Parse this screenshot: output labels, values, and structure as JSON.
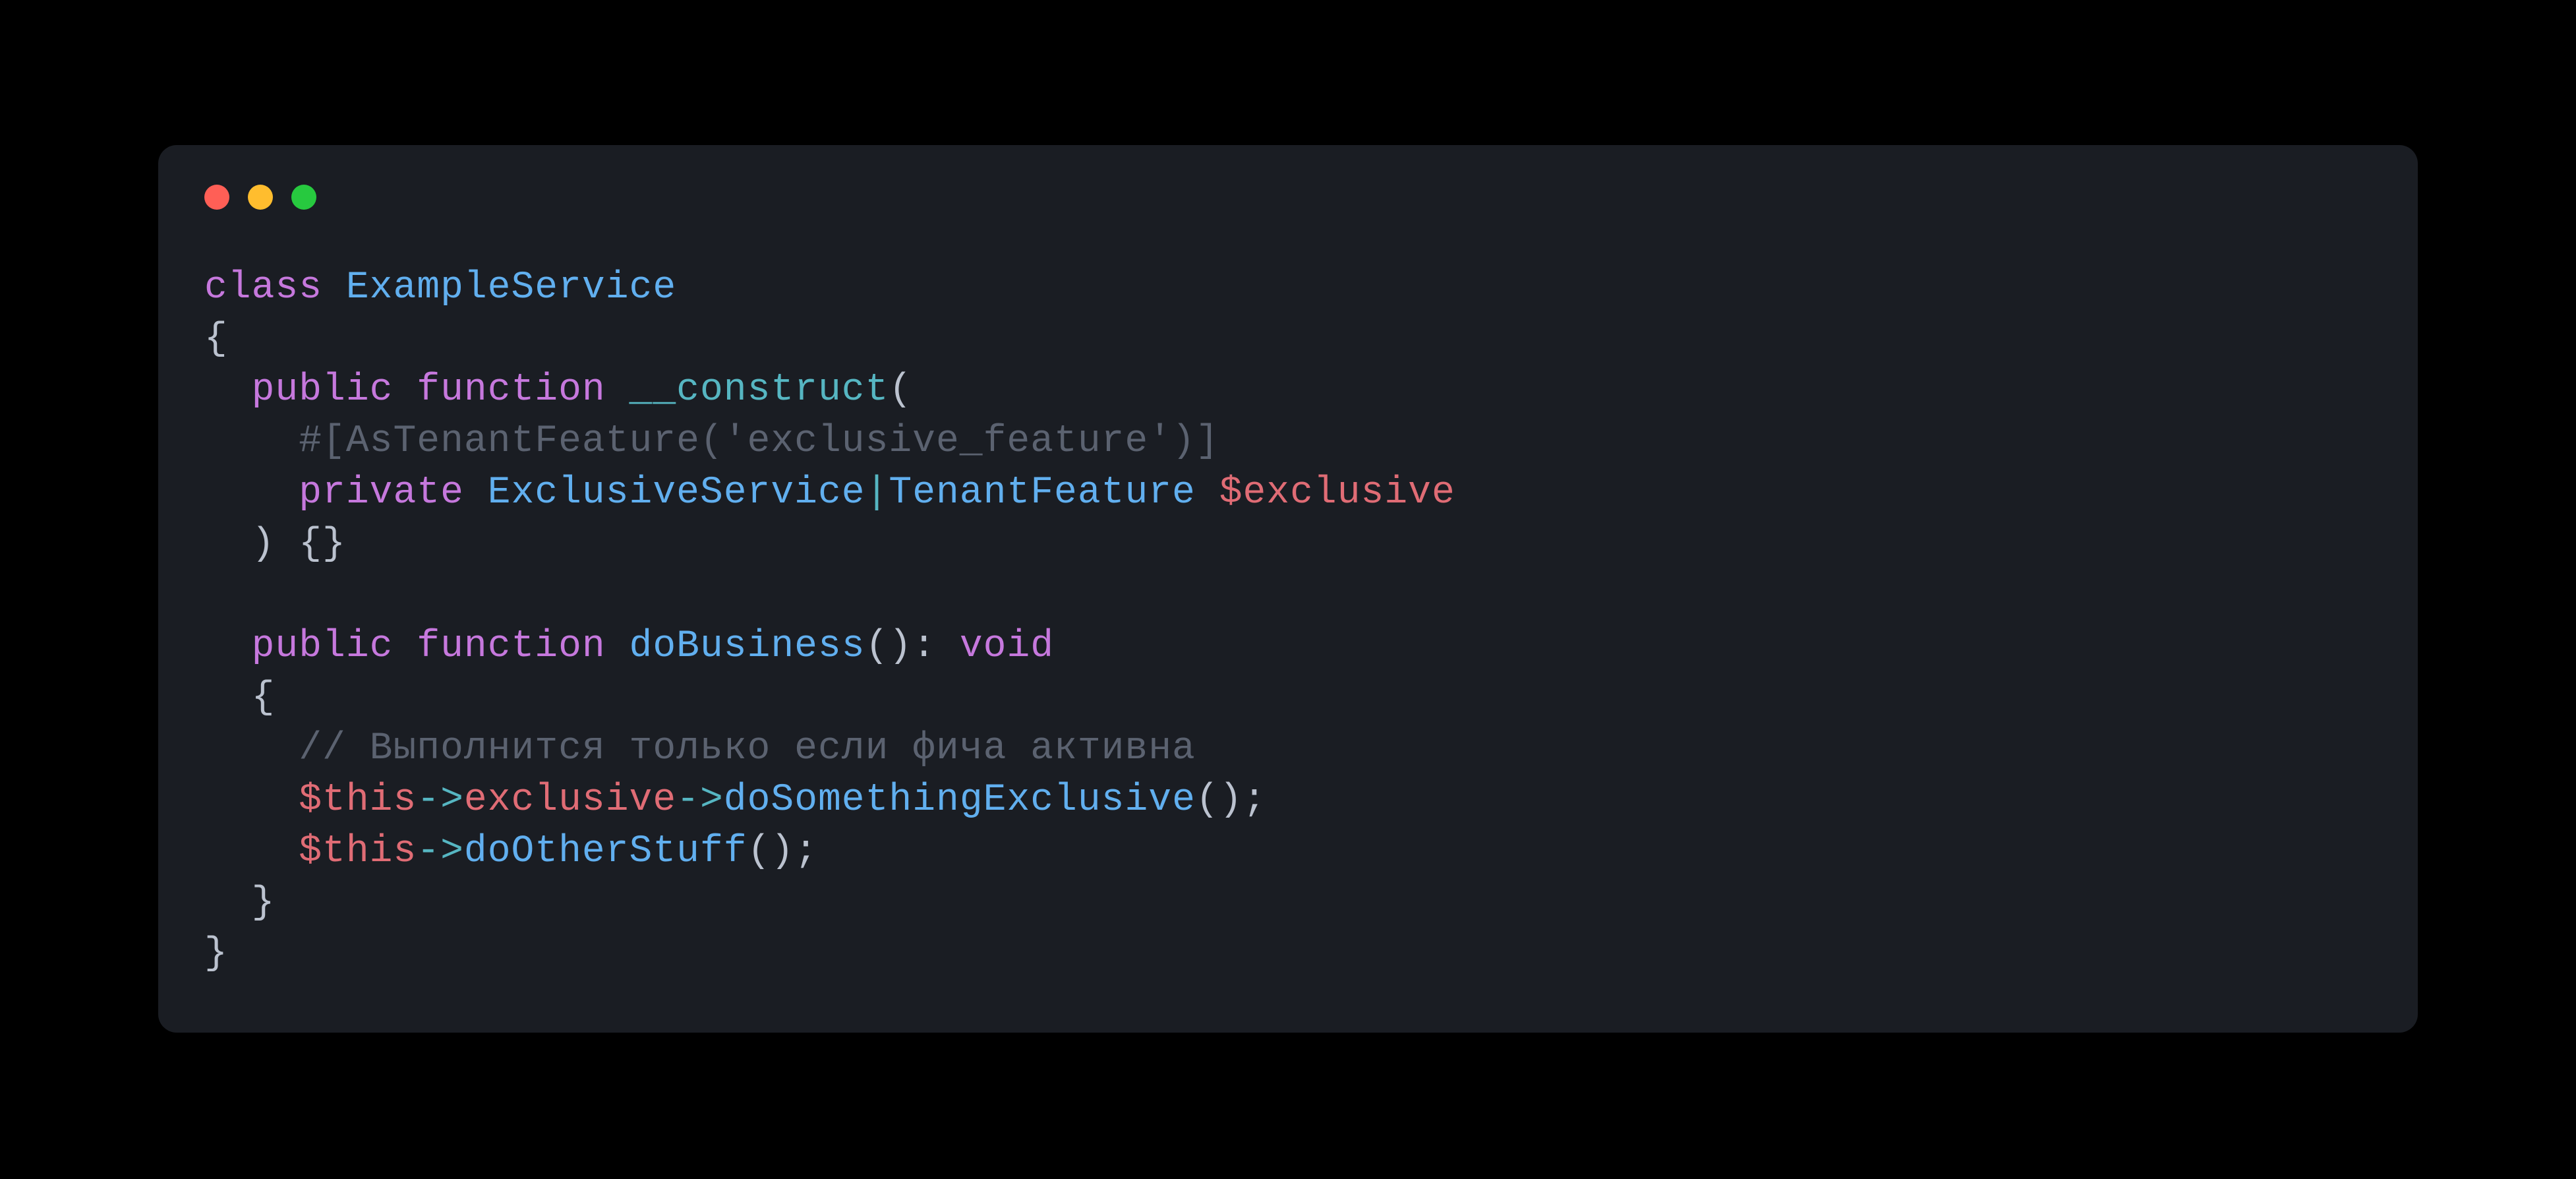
{
  "code": {
    "indent": "  ",
    "indent2": "    ",
    "l1_kw_class": "class",
    "l1_cls": "ExampleService",
    "l2_open": "{",
    "l3_kw_public": "public",
    "l3_kw_function": "function",
    "l3_fn": "__construct",
    "l3_paren_open": "(",
    "l4_attr": "#[AsTenantFeature('exclusive_feature')]",
    "l5_kw_private": "private",
    "l5_type1": "ExclusiveService",
    "l5_pipe": "|",
    "l5_type2": "TenantFeature",
    "l5_var": "$exclusive",
    "l6_close": ") {}",
    "l8_kw_public": "public",
    "l8_kw_function": "function",
    "l8_fn": "doBusiness",
    "l8_sig": "():",
    "l8_void": "void",
    "l9_open": "{",
    "l10_comment": "// Выполнится только если фича активна",
    "l11_this": "$this",
    "l11_arrow": "->",
    "l11_prop": "exclusive",
    "l11_arrow2": "->",
    "l11_call": "doSomethingExclusive",
    "l11_end": "();",
    "l12_this": "$this",
    "l12_arrow": "->",
    "l12_call": "doOtherStuff",
    "l12_end": "();",
    "l13_close": "}",
    "l14_close": "}"
  },
  "colors": {
    "bg": "#000000",
    "card": "#1a1d23",
    "red": "#ff5f56",
    "yellow": "#ffbd2e",
    "green": "#27c93f",
    "keyword": "#c678dd",
    "class": "#61afef",
    "function": "#61afef",
    "magic": "#56b6c2",
    "string": "#98c379",
    "variable": "#e06c75",
    "punct": "#bbc2cf",
    "operator": "#56b6c2",
    "dim": "#5b6270"
  }
}
